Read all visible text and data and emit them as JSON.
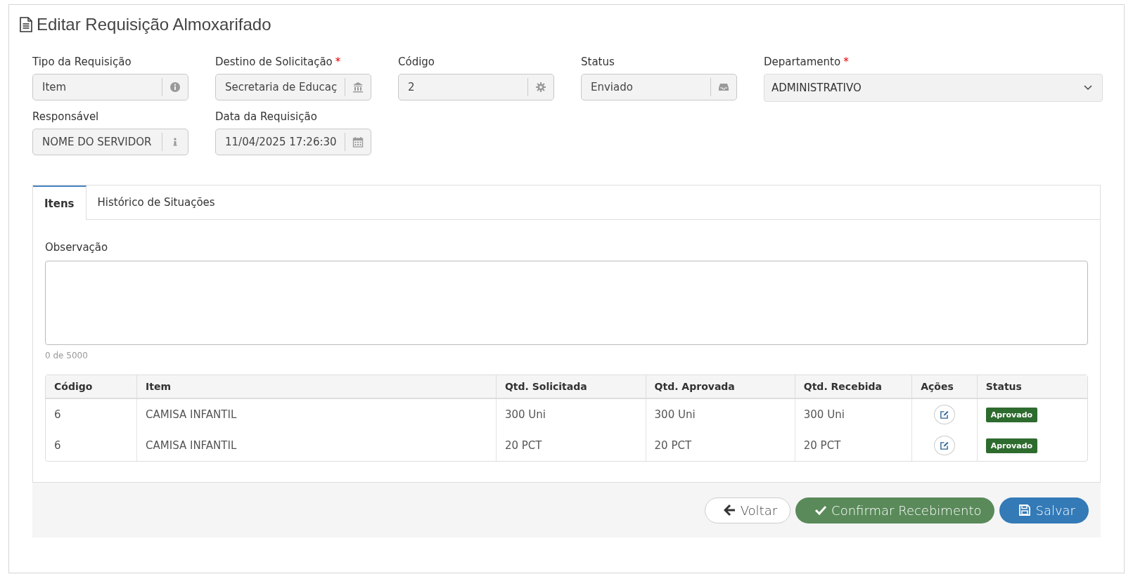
{
  "title": "Editar Requisição Almoxarifado",
  "fields": [
    {
      "label": "Tipo da Requisição",
      "value": "Item",
      "kind": "input"
    },
    {
      "label": "Destino de Solicitação",
      "required_mark": "*",
      "value": "Secretaria de Educaç",
      "kind": "input"
    },
    {
      "label": "Código",
      "value": "2",
      "kind": "input"
    },
    {
      "label": "Status",
      "value": "Enviado",
      "kind": "input"
    },
    {
      "label": "Departamento",
      "required_mark": "*",
      "value": "ADMINISTRATIVO",
      "kind": "select"
    },
    {
      "label": "Responsável",
      "value": "NOME DO SERVIDOR",
      "kind": "input"
    },
    {
      "label": "Data da Requisição",
      "value": "11/04/2025 17:26:30",
      "kind": "input"
    }
  ],
  "tabs": [
    {
      "label": "Itens",
      "selected": true
    },
    {
      "label": "Histórico de Situações",
      "selected": false
    }
  ],
  "observation": {
    "label": "Observação",
    "counter": "0 de 5000"
  },
  "table": {
    "columns": [
      "Código",
      "Item",
      "Qtd. Solicitada",
      "Qtd. Aprovada",
      "Qtd. Recebida",
      "Ações",
      "Status"
    ],
    "rows": [
      {
        "code": "6",
        "item": "CAMISA INFANTIL",
        "requested": "300 Uni",
        "approved": "300 Uni",
        "received": "300 Uni",
        "status": "Aprovado",
        "color": "#2e6b2e"
      },
      {
        "code": "6",
        "item": "CAMISA INFANTIL",
        "requested": "20 PCT",
        "approved": "20 PCT",
        "received": "20 PCT",
        "status": "Aprovado",
        "color": "#2e6b2e"
      }
    ]
  },
  "buttons": [
    {
      "label": "Voltar",
      "kind": "back"
    },
    {
      "label": "Confirmar Recebimento",
      "kind": "confirm"
    },
    {
      "label": "Salvar",
      "kind": "save"
    }
  ]
}
